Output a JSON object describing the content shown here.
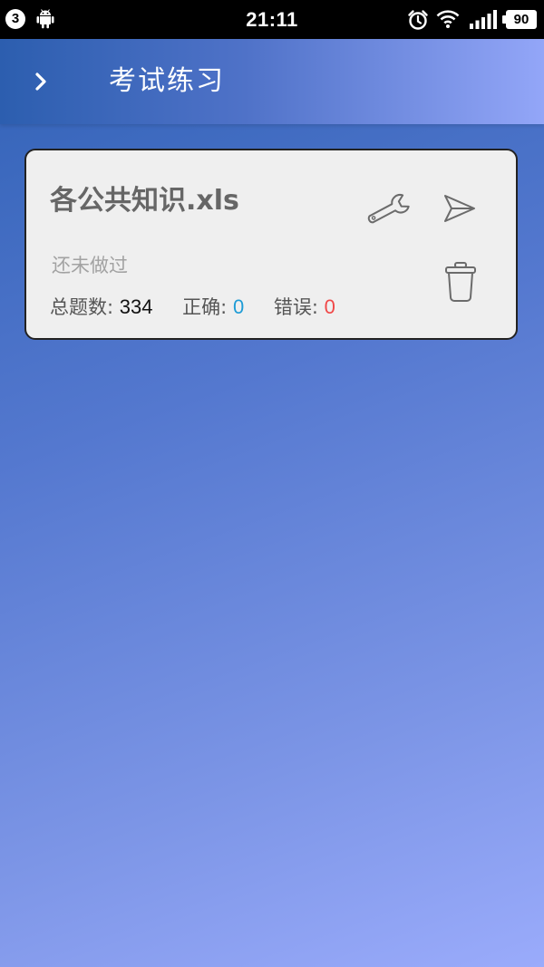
{
  "status_bar": {
    "notification_count": "3",
    "time": "21:11",
    "battery": "90",
    "icons": [
      "android-icon",
      "alarm-icon",
      "wifi-icon",
      "signal-icon"
    ]
  },
  "header": {
    "title": "考试练习",
    "menu_icon": "chevron-right-icon",
    "gradient_colors": [
      "#2c5eaf",
      "#93a6f8"
    ]
  },
  "exam_card": {
    "file_name": "各公共知识.xls",
    "status": "还未做过",
    "total_label": "总题数:",
    "total_value": "334",
    "correct_label": "正确:",
    "correct_value": "0",
    "wrong_label": "错误:",
    "wrong_value": "0",
    "actions": [
      "wrench-icon",
      "send-icon",
      "trash-icon"
    ],
    "colors": {
      "correct": "#1e9cd6",
      "wrong": "#f04848",
      "background": "#efefef"
    }
  }
}
